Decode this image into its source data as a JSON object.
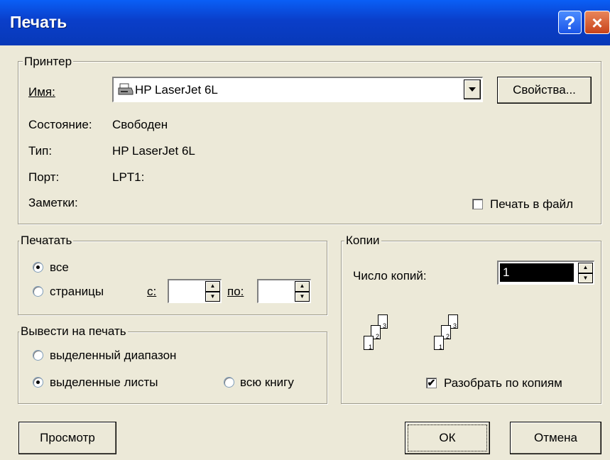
{
  "window": {
    "title": "Печать",
    "help_icon": "?",
    "close_icon": "×"
  },
  "printer": {
    "legend": "Принтер",
    "name_label": "Имя:",
    "name_value": "HP LaserJet 6L",
    "properties_button": "Свойства...",
    "status_label": "Состояние:",
    "status_value": "Свободен",
    "type_label": "Тип:",
    "type_value": "HP LaserJet 6L",
    "port_label": "Порт:",
    "port_value": "LPT1:",
    "notes_label": "Заметки:",
    "print_to_file_label": "Печать в файл",
    "print_to_file_checked": false
  },
  "print_range": {
    "legend": "Печатать",
    "all_label": "все",
    "pages_label": "страницы",
    "from_label": "с:",
    "to_label": "по:",
    "from_value": "",
    "to_value": "",
    "selected": "all"
  },
  "print_what": {
    "legend": "Вывести на печать",
    "selection_label": "выделенный диапазон",
    "sheets_label": "выделенные листы",
    "workbook_label": "всю книгу",
    "selected": "sheets"
  },
  "copies": {
    "legend": "Копии",
    "count_label": "Число копий:",
    "count_value": "1",
    "collate_label": "Разобрать по копиям",
    "collate_checked": true,
    "page_numbers": [
      "1",
      "2",
      "3"
    ]
  },
  "buttons": {
    "preview": "Просмотр",
    "ok": "ОК",
    "cancel": "Отмена"
  },
  "icons": {
    "printer": "printer-icon",
    "dropdown": "chevron-down-icon",
    "spin_up": "spin-up-icon",
    "spin_down": "spin-down-icon"
  }
}
